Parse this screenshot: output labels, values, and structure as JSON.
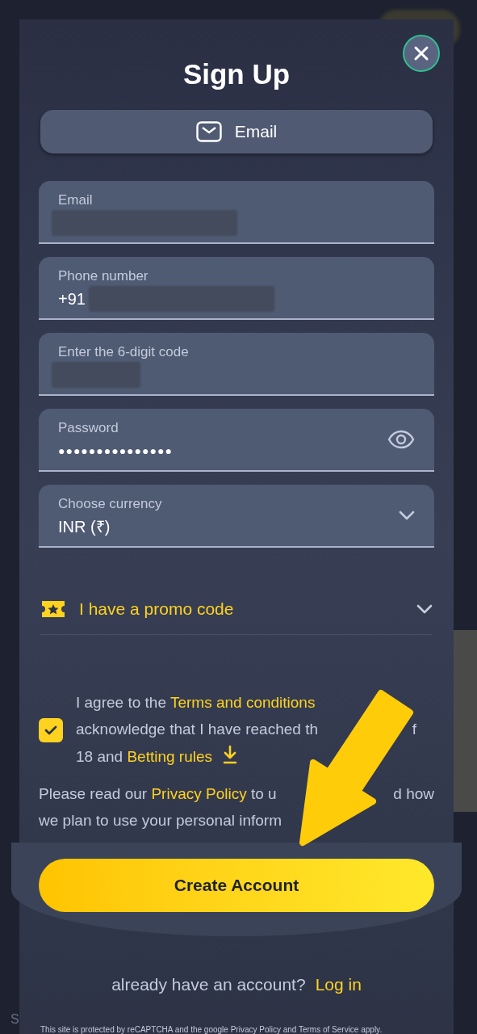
{
  "dialog": {
    "title": "Sign Up",
    "method_tab": {
      "label": "Email",
      "selected": true
    }
  },
  "fields": [
    {
      "kind": "redacted",
      "label": "Email"
    },
    {
      "kind": "phone",
      "label": "Phone number",
      "prefix": "+91"
    },
    {
      "kind": "redacted",
      "label": "Enter the 6-digit code"
    },
    {
      "kind": "password",
      "label": "Password",
      "value": "●●●●●●●●●●●●●●●"
    },
    {
      "kind": "select",
      "label": "Choose currency",
      "value": "INR (₹)"
    }
  ],
  "promo": {
    "label": "I have a promo code",
    "expanded": false
  },
  "consent": {
    "checked": true,
    "lines": [
      {
        "parts": [
          {
            "kind": "plain",
            "text": "I agree to the "
          },
          {
            "kind": "link",
            "text": "Terms and conditions"
          }
        ]
      },
      {
        "parts": [
          {
            "kind": "plain",
            "text": "acknowledge that I have reached th"
          }
        ],
        "after_arrow": "f"
      },
      {
        "parts": [
          {
            "kind": "plain",
            "text": "18 and "
          },
          {
            "kind": "link",
            "text": "Betting rules"
          },
          {
            "kind": "download"
          }
        ]
      }
    ]
  },
  "privacy": {
    "lines": [
      {
        "parts": [
          {
            "kind": "plain",
            "text": "Please read our "
          },
          {
            "kind": "link",
            "text": "Privacy Policy"
          },
          {
            "kind": "plain",
            "text": " to u"
          }
        ],
        "after_arrow": "d how"
      },
      {
        "parts": [
          {
            "kind": "plain",
            "text": "we plan to use your personal inform"
          }
        ]
      }
    ]
  },
  "submit": "Create Account",
  "login": {
    "prompt": "already have an account?",
    "link": "Log in"
  },
  "footer": "This site is protected by reCAPTCHA and the google Privacy Policy and Terms of Service apply.",
  "background_text": "S"
}
